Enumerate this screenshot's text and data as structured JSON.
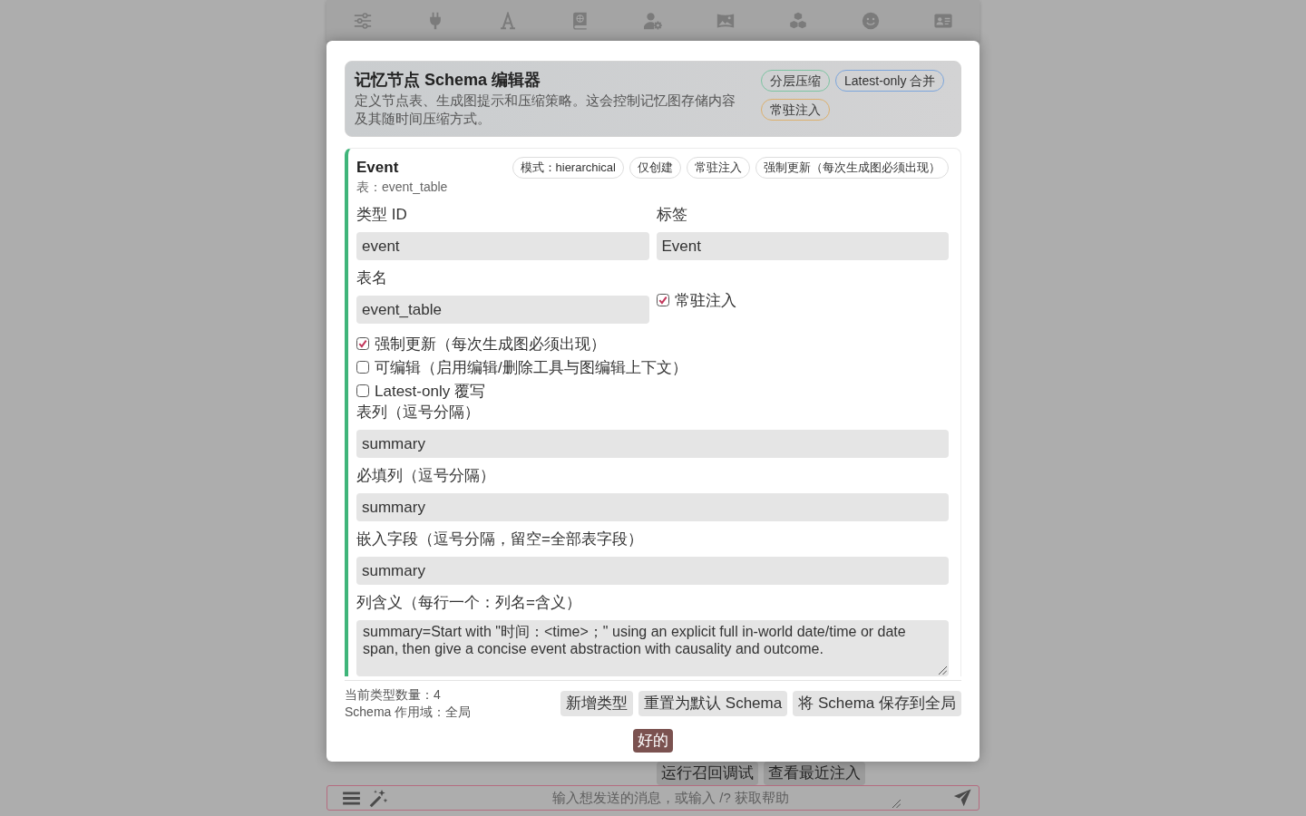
{
  "dialog": {
    "header": {
      "title": "记忆节点 Schema 编辑器",
      "description": "定义节点表、生成图提示和压缩策略。这会控制记忆图存储内容及其随时间压缩方式。",
      "badges": [
        {
          "label": "分层压缩",
          "color": "#7dc4a2"
        },
        {
          "label": "Latest-only 合并",
          "color": "#7ca6dc"
        },
        {
          "label": "常驻注入",
          "color": "#dcb06e"
        }
      ]
    },
    "node_types": [
      {
        "name": "Event",
        "color": "#3fb57a",
        "table": "表：event_table",
        "tags": [
          "模式：hierarchical",
          "仅创建",
          "常驻注入",
          "强制更新（每次生成图必须出现）"
        ],
        "primary_fields": [
          {
            "kind": "input",
            "label": "类型 ID",
            "value": "event"
          },
          {
            "kind": "input",
            "label": "标签",
            "value": "Event"
          },
          {
            "kind": "input",
            "label": "表名",
            "value": "event_table"
          },
          {
            "kind": "checkbox",
            "label": "常驻注入",
            "checked": true
          }
        ],
        "fields": [
          {
            "kind": "checkbox",
            "label": "强制更新（每次生成图必须出现）",
            "checked": true
          },
          {
            "kind": "checkbox",
            "label": "可编辑（启用编辑/删除工具与图编辑上下文）",
            "checked": false
          },
          {
            "kind": "checkbox",
            "label": "Latest-only 覆写",
            "checked": false
          },
          {
            "kind": "input",
            "label": "表列（逗号分隔）",
            "value": "summary"
          },
          {
            "kind": "input",
            "label": "必填列（逗号分隔）",
            "value": "summary"
          },
          {
            "kind": "input",
            "label": "嵌入字段（逗号分隔，留空=全部表字段）",
            "value": "summary"
          },
          {
            "kind": "textarea",
            "label": "列含义（每行一个：列名=含义）",
            "value": "summary=Start with \"时间：<time>；\" using an explicit full in-world date/time or date span, then give a concise event abstraction with causality and outcome."
          }
        ]
      }
    ],
    "stats": [
      "当前类型数量：4",
      "Schema 作用域：全局"
    ],
    "buttons": [
      "新增类型",
      "重置为默认 Schema",
      "将 Schema 保存到全局"
    ],
    "confirm_button": "好的"
  },
  "background": {
    "actions": [
      "运行召回调试",
      "查看最近注入"
    ],
    "message_field": {
      "placeholder": "输入想发送的消息，或输入 /? 获取帮助"
    }
  }
}
